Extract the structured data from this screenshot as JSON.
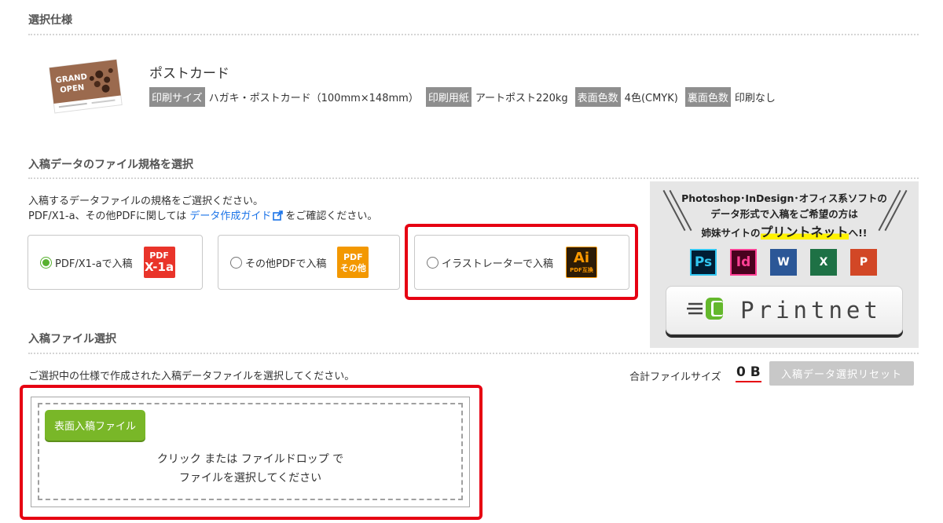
{
  "sections": {
    "spec_title": "選択仕様",
    "format_title": "入稿データのファイル規格を選択",
    "file_title": "入稿ファイル選択"
  },
  "product": {
    "thumb_text_1": "GRAND",
    "thumb_text_2": "OPEN",
    "name": "ポストカード",
    "specs": [
      {
        "label": "印刷サイズ",
        "value": "ハガキ・ポストカード（100mm×148mm）"
      },
      {
        "label": "印刷用紙",
        "value": "アートポスト220kg"
      },
      {
        "label": "表面色数",
        "value": "4色(CMYK)"
      },
      {
        "label": "裏面色数",
        "value": "印刷なし"
      }
    ]
  },
  "format": {
    "desc_line1": "入稿するデータファイルの規格をご選択ください。",
    "desc_line2_prefix": "PDF/X1-a、その他PDFに関しては",
    "guide_link": "データ作成ガイド",
    "desc_line2_suffix": "をご確認ください。",
    "options": [
      {
        "label": "PDF/X1-aで入稿",
        "badge_top": "PDF",
        "badge_bottom": "X-1a",
        "badge_color": "#e9342a",
        "selected": true
      },
      {
        "label": "その他PDFで入稿",
        "badge_top": "PDF",
        "badge_bottom": "その他",
        "badge_color": "#f39800",
        "selected": false
      },
      {
        "label": "イラストレーターで入稿",
        "badge_top": "Ai",
        "badge_bottom": "PDF互換",
        "badge_color": "#2d1c06",
        "selected": false
      }
    ]
  },
  "banner": {
    "line1": "Photoshop･InDesign･オフィス系ソフトの",
    "line2": "データ形式で入稿をご希望の方は",
    "line3_prefix": "姉妹サイトの",
    "line3_emphasis": "プリントネット",
    "line3_suffix": "へ!!",
    "icons": [
      {
        "name": "photoshop-icon",
        "text": "Ps",
        "bg": "#001d34",
        "fg": "#31c5f0"
      },
      {
        "name": "indesign-icon",
        "text": "Id",
        "bg": "#49021f",
        "fg": "#ff3f94"
      },
      {
        "name": "word-icon",
        "text": "W",
        "bg": "#2b5797",
        "fg": "#ffffff"
      },
      {
        "name": "excel-icon",
        "text": "X",
        "bg": "#1e7145",
        "fg": "#ffffff"
      },
      {
        "name": "powerpoint-icon",
        "text": "P",
        "bg": "#d24726",
        "fg": "#ffffff"
      }
    ],
    "logo_text": "Printnet"
  },
  "files": {
    "instruction": "ご選択中の仕様で作成された入稿データファイルを選択してください。",
    "total_label": "合計ファイルサイズ",
    "total_value": "0 B",
    "reset_label": "入稿データ選択リセット",
    "front_button": "表面入稿ファイル",
    "drop_line1": "クリック または ファイルドロップ で",
    "drop_line2": "ファイルを選択してください"
  },
  "colors": {
    "highlight": "#e60012",
    "accent_green": "#79b728",
    "link": "#1a73e8"
  }
}
